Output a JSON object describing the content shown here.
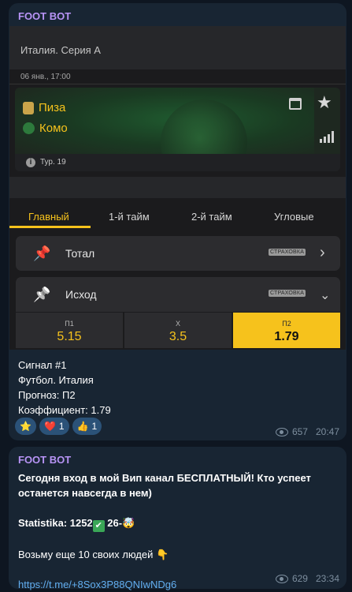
{
  "colors": {
    "accent": "#f6c21c",
    "sender": "#b894f6",
    "link": "#62aef0",
    "bubble": "#182533",
    "bg": "#0e1621"
  },
  "message1": {
    "sender": "FOOT BOT",
    "league": "Италия. Серия А",
    "date": "06 янв., 17:00",
    "teams": {
      "home": "Пиза",
      "away": "Комо"
    },
    "round": "Тур. 19",
    "tabs": [
      "Главный",
      "1-й тайм",
      "2-й тайм",
      "Угловые"
    ],
    "active_tab": "Главный",
    "rows": {
      "total": "Тотал",
      "outcome": "Исход",
      "badge": "СТРАХОВКА"
    },
    "odds": [
      {
        "label": "П1",
        "value": "5.15"
      },
      {
        "label": "Х",
        "value": "3.5"
      },
      {
        "label": "П2",
        "value": "1.79"
      }
    ],
    "selected_odd": "П2",
    "text": [
      "Сигнал #1",
      "Футбол. Италия",
      "Прогноз: П2",
      "Коэффициент: 1.79"
    ],
    "reactions": [
      {
        "emoji": "⭐",
        "count": ""
      },
      {
        "emoji": "❤️",
        "count": "1"
      },
      {
        "emoji": "👍",
        "count": "1"
      }
    ],
    "views": "657",
    "time": "20:47"
  },
  "message2": {
    "sender": "FOOT BOT",
    "line1": "Сегодня вход в мой Вип канал  БЕСПЛАТНЫЙ!  Кто успеет останется навсегда в нем)",
    "stats_prefix": "Statistika: 1252",
    "stats_check": "✅",
    "stats_mid": " 26-",
    "stats_emoji": "🤯",
    "line3": "Возьму еще 10 своих людей",
    "line3_emoji": "👇",
    "link": "https://t.me/+8Sox3P88QNIwNDg6",
    "views": "629",
    "time": "23:34"
  }
}
